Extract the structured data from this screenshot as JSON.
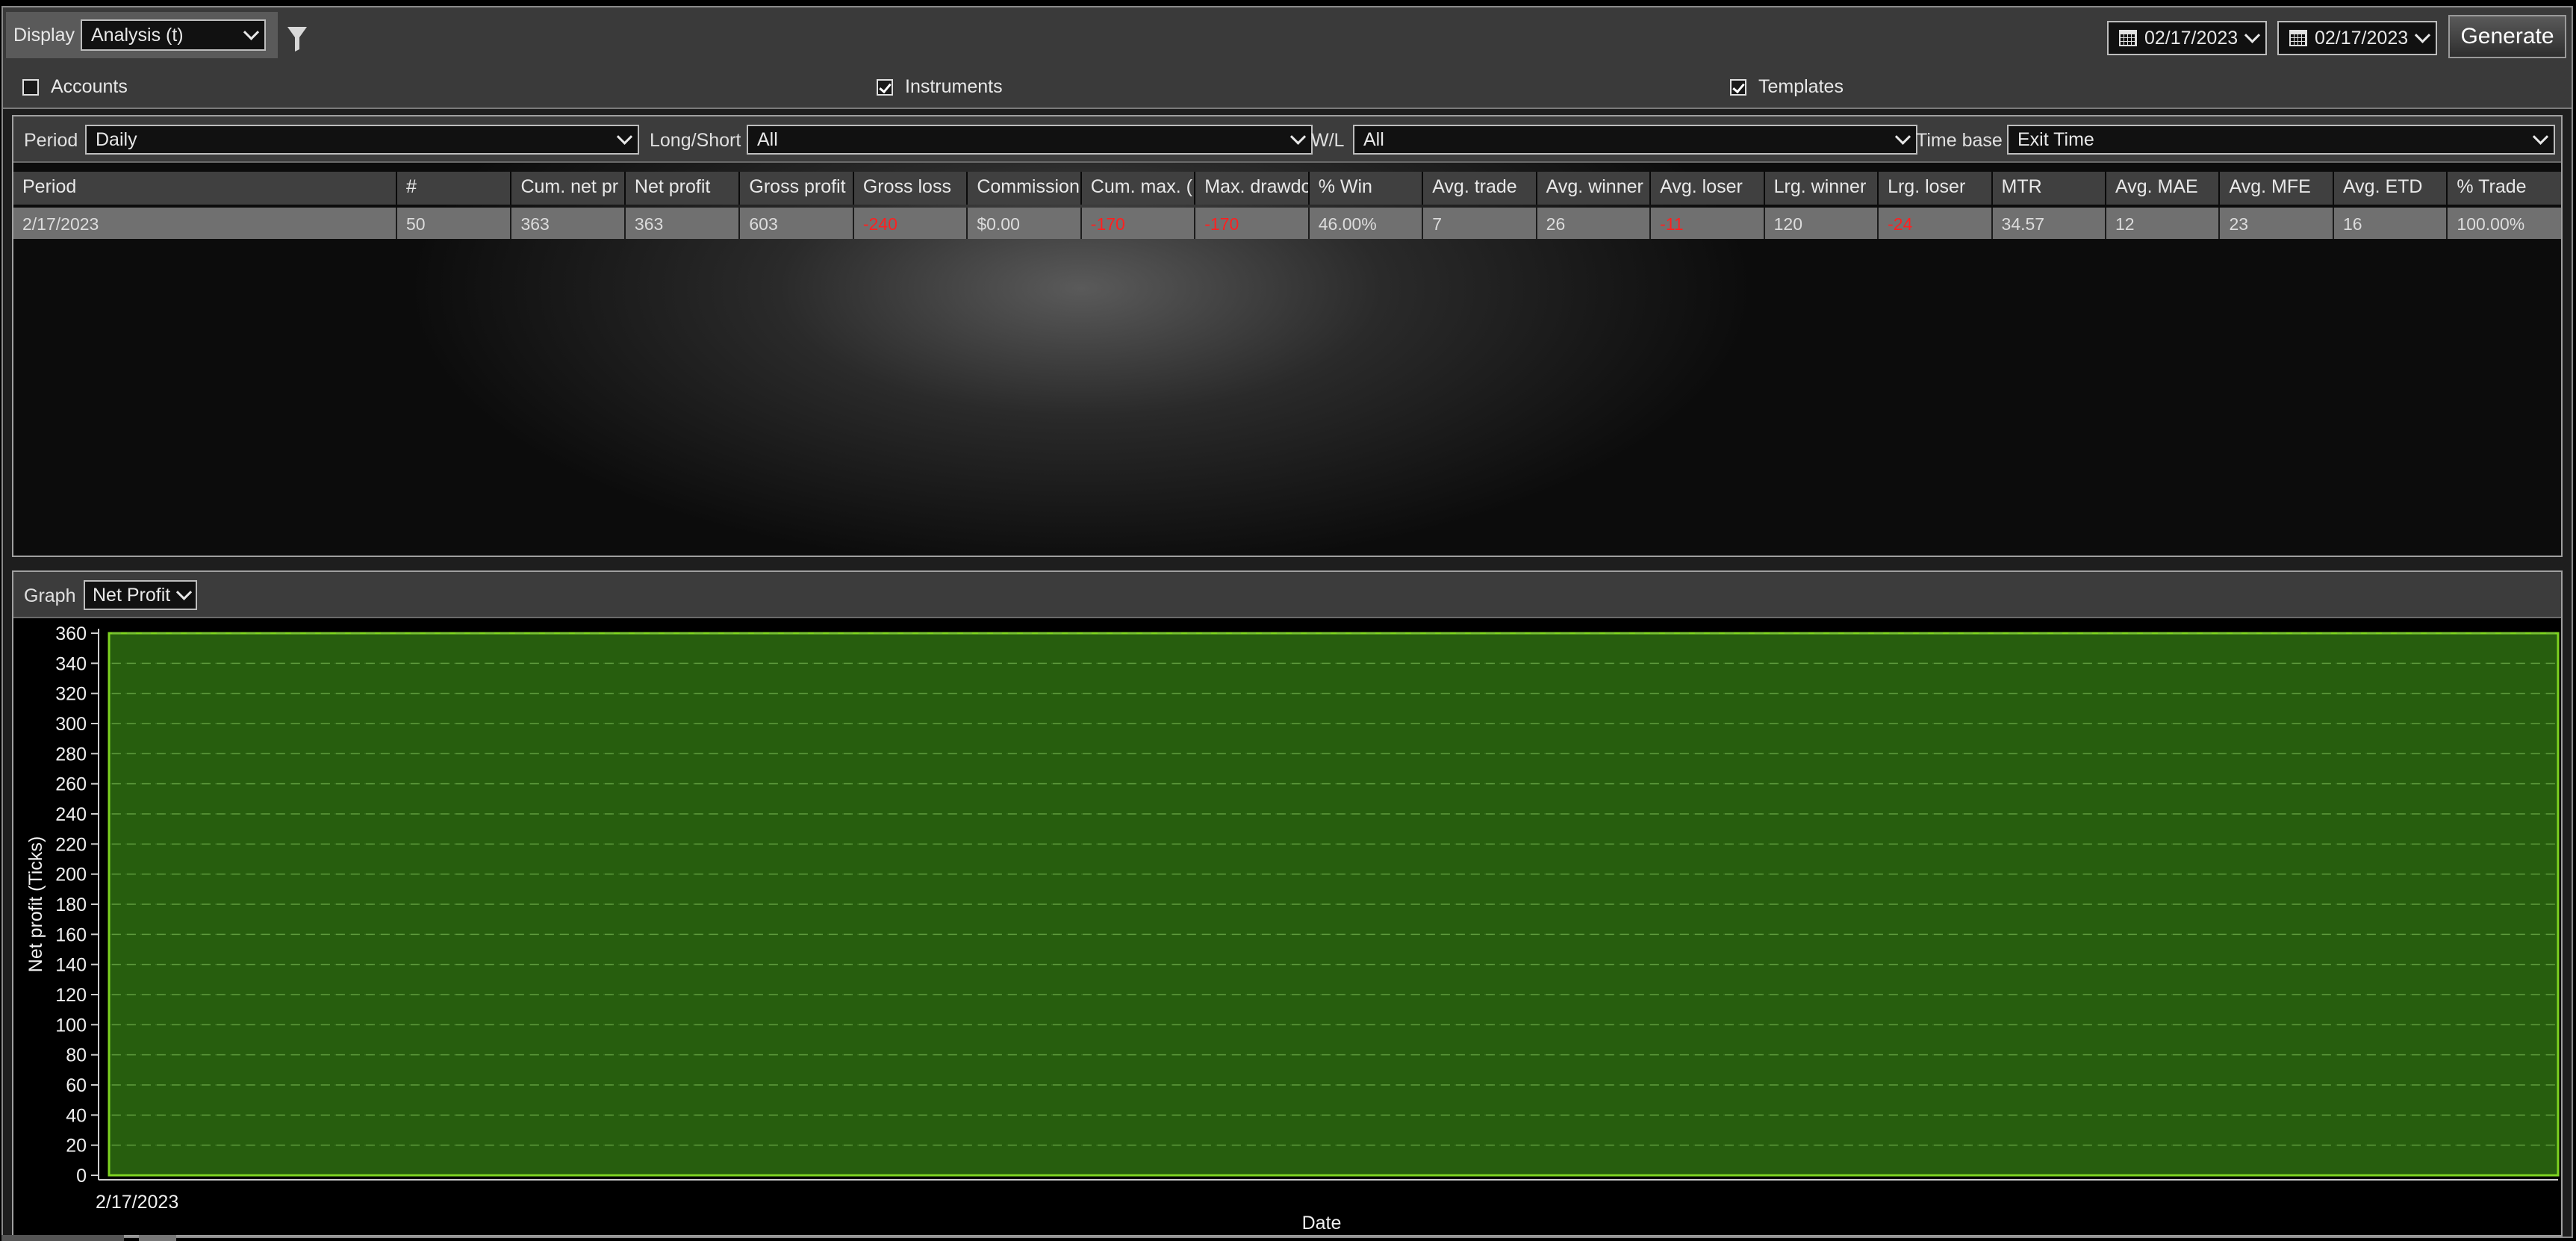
{
  "toolbar": {
    "display_label": "Display",
    "display_value": "Analysis (t)",
    "date_from": "02/17/2023",
    "date_to": "02/17/2023",
    "generate_label": "Generate",
    "checks": [
      {
        "label": "Accounts",
        "checked": false
      },
      {
        "label": "Instruments",
        "checked": true
      },
      {
        "label": "Templates",
        "checked": true
      }
    ]
  },
  "filters": {
    "period_label": "Period",
    "period_value": "Daily",
    "longshort_label": "Long/Short",
    "longshort_value": "All",
    "wl_label": "W/L",
    "wl_value": "All",
    "timebase_label": "Time base",
    "timebase_value": "Exit Time"
  },
  "grid": {
    "columns": [
      "Period",
      "#",
      "Cum. net pr",
      "Net profit",
      "Gross profit",
      "Gross loss",
      "Commission",
      "Cum. max. (",
      "Max. drawdo",
      "% Win",
      "Avg. trade",
      "Avg. winner",
      "Avg. loser",
      "Lrg. winner",
      "Lrg. loser",
      "MTR",
      "Avg. MAE",
      "Avg. MFE",
      "Avg. ETD",
      "% Trade"
    ],
    "rows": [
      [
        "2/17/2023",
        "50",
        "363",
        "363",
        "603",
        "-240",
        "$0.00",
        "-170",
        "-170",
        "46.00%",
        "7",
        "26",
        "-11",
        "120",
        "-24",
        "34.57",
        "12",
        "23",
        "16",
        "100.00%"
      ]
    ],
    "negative_color": "#ff2020"
  },
  "graph": {
    "label": "Graph",
    "value": "Net Profit"
  },
  "chart_data": {
    "type": "area",
    "x": [
      "2/17/2023"
    ],
    "values": [
      363
    ],
    "xlabel": "Date",
    "ylabel": "Net profit (Ticks)",
    "ylim": [
      0,
      360
    ],
    "yticks": [
      0,
      20,
      40,
      60,
      80,
      100,
      120,
      140,
      160,
      180,
      200,
      220,
      240,
      260,
      280,
      300,
      320,
      340,
      360
    ],
    "grid": true,
    "fill_color": "#2e6e10",
    "line_color": "#7ed321"
  }
}
